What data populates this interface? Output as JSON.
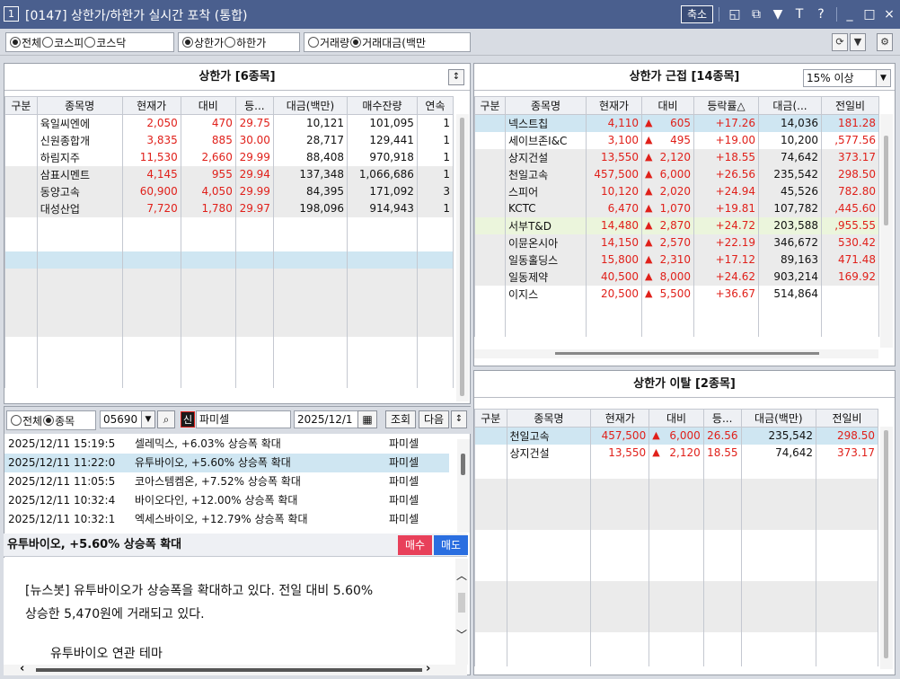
{
  "window": {
    "number": "1",
    "title": "[0147] 상한가/하한가 실시간 포착 (통합)",
    "shrink_label": "축소",
    "icons": [
      "restore-icon",
      "window-icon",
      "pin-icon",
      "font-icon",
      "help-icon",
      "minimize-icon",
      "maximize-icon",
      "close-icon"
    ]
  },
  "toolbar": {
    "market": [
      "전체",
      "코스피",
      "코스닥"
    ],
    "market_selected": 0,
    "limit": [
      "상한가",
      "하한가"
    ],
    "limit_selected": 0,
    "sort": [
      "거래량",
      "거래대금(백만"
    ],
    "sort_selected": 1
  },
  "upper": {
    "title": "상한가 [6종목]",
    "columns": [
      "구분",
      "종목명",
      "현재가",
      "대비",
      "등...",
      "대금(백만)",
      "매수잔량",
      "연속"
    ],
    "rows": [
      {
        "name": "육일씨엔에",
        "price": "2,050",
        "diff": "470",
        "rate": "29.75",
        "amt": "10,121",
        "bid": "101,095",
        "streak": "1"
      },
      {
        "name": "신원종합개",
        "price": "3,835",
        "diff": "885",
        "rate": "30.00",
        "amt": "28,717",
        "bid": "129,441",
        "streak": "1"
      },
      {
        "name": "하림지주",
        "price": "11,530",
        "diff": "2,660",
        "rate": "29.99",
        "amt": "88,408",
        "bid": "970,918",
        "streak": "1"
      },
      {
        "name": "삼표시멘트",
        "price": "4,145",
        "diff": "955",
        "rate": "29.94",
        "amt": "137,348",
        "bid": "1,066,686",
        "streak": "1"
      },
      {
        "name": "동양고속",
        "price": "60,900",
        "diff": "4,050",
        "rate": "29.99",
        "amt": "84,395",
        "bid": "171,092",
        "streak": "3"
      },
      {
        "name": "대성산업",
        "price": "7,720",
        "diff": "1,780",
        "rate": "29.97",
        "amt": "198,096",
        "bid": "914,943",
        "streak": "1"
      }
    ]
  },
  "near": {
    "title": "상한가 근접 [14종목]",
    "filter": "15% 이상",
    "columns": [
      "구분",
      "종목명",
      "현재가",
      "대비",
      "등락률△",
      "대금(...",
      "전일비"
    ],
    "rows": [
      {
        "name": "넥스트칩",
        "price": "4,110",
        "diff": "605",
        "rate": "+17.26",
        "amt": "14,036",
        "prev": "181.28"
      },
      {
        "name": "세이브존I&C",
        "price": "3,100",
        "diff": "495",
        "rate": "+19.00",
        "amt": "10,200",
        "prev": ",577.56"
      },
      {
        "name": "상지건설",
        "price": "13,550",
        "diff": "2,120",
        "rate": "+18.55",
        "amt": "74,642",
        "prev": "373.17"
      },
      {
        "name": "천일고속",
        "price": "457,500",
        "diff": "6,000",
        "rate": "+26.56",
        "amt": "235,542",
        "prev": "298.50"
      },
      {
        "name": "스피어",
        "price": "10,120",
        "diff": "2,020",
        "rate": "+24.94",
        "amt": "45,526",
        "prev": "782.80"
      },
      {
        "name": "KCTC",
        "price": "6,470",
        "diff": "1,070",
        "rate": "+19.81",
        "amt": "107,782",
        "prev": ",445.60"
      },
      {
        "name": "서부T&D",
        "price": "14,480",
        "diff": "2,870",
        "rate": "+24.72",
        "amt": "203,588",
        "prev": ",955.55"
      },
      {
        "name": "이뮨온시아",
        "price": "14,150",
        "diff": "2,570",
        "rate": "+22.19",
        "amt": "346,672",
        "prev": "530.42"
      },
      {
        "name": "일동홀딩스",
        "price": "15,800",
        "diff": "2,310",
        "rate": "+17.12",
        "amt": "89,163",
        "prev": "471.48"
      },
      {
        "name": "일동제약",
        "price": "40,500",
        "diff": "8,000",
        "rate": "+24.62",
        "amt": "903,214",
        "prev": "169.92"
      },
      {
        "name": "이지스",
        "price": "20,500",
        "diff": "5,500",
        "rate": "+36.67",
        "amt": "514,864",
        "prev": ""
      }
    ]
  },
  "departure": {
    "title": "상한가 이탈 [2종목]",
    "columns": [
      "구분",
      "종목명",
      "현재가",
      "대비",
      "등...",
      "대금(백만)",
      "전일비"
    ],
    "rows": [
      {
        "name": "천일고속",
        "price": "457,500",
        "diff": "6,000",
        "rate": "26.56",
        "amt": "235,542",
        "prev": "298.50"
      },
      {
        "name": "상지건설",
        "price": "13,550",
        "diff": "2,120",
        "rate": "18.55",
        "amt": "74,642",
        "prev": "373.17"
      }
    ]
  },
  "news": {
    "scope": [
      "전체",
      "종목"
    ],
    "scope_selected": 1,
    "code": "05690",
    "badge": "신",
    "stock_name": "파미셀",
    "date": "2025/12/1",
    "query_label": "조회",
    "next_label": "다음",
    "items": [
      {
        "time": "2025/12/11 15:19:5",
        "headline": "셀레믹스, +6.03% 상승폭 확대",
        "tag": "파미셀"
      },
      {
        "time": "2025/12/11 11:22:0",
        "headline": "유투바이오, +5.60% 상승폭 확대",
        "tag": "파미셀"
      },
      {
        "time": "2025/12/11 11:05:5",
        "headline": "코아스템켐온, +7.52% 상승폭 확대",
        "tag": "파미셀"
      },
      {
        "time": "2025/12/11 10:32:4",
        "headline": "바이오다인, +12.00% 상승폭 확대",
        "tag": "파미셀"
      },
      {
        "time": "2025/12/11 10:32:1",
        "headline": "엑세스바이오, +12.79% 상승폭 확대",
        "tag": "파미셀"
      }
    ],
    "selected": 1
  },
  "article": {
    "title": "유투바이오, +5.60% 상승폭 확대",
    "buy_label": "매수",
    "sell_label": "매도",
    "line1": "[뉴스봇] 유투바이오가 상승폭을 확대하고 있다. 전일 대비 5.60%",
    "line2": "상승한 5,470원에 거래되고 있다.",
    "line3": "유투바이오 연관 테마"
  }
}
